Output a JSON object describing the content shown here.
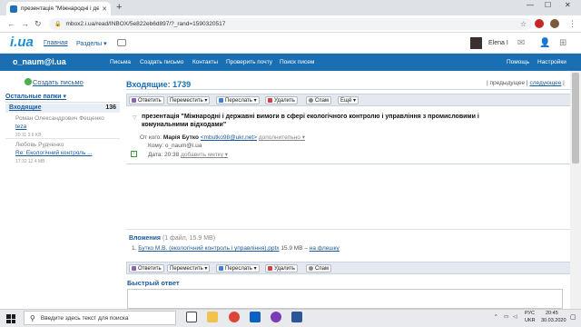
{
  "browser": {
    "tab_title": "презентація \"Міжнародні і держ",
    "tab_close": "✕",
    "new_tab": "+",
    "url": "mbox2.i.ua/read/INBOX/5e822eb6d897/?_rand=1590320517",
    "win_min": "—",
    "win_max": "☐",
    "win_close": "✕"
  },
  "site": {
    "logo_text": "i.ua",
    "nav": [
      "Главная",
      "Разделы ▾"
    ],
    "user_name": "Elena I",
    "email": "o_naum@i.ua",
    "menu": [
      "Письма",
      "Создать письмо",
      "Контакты",
      "Проверить почту",
      "Поиск писем"
    ],
    "help": "Помощь",
    "settings": "Настройки"
  },
  "sidebar": {
    "create_label": "Создать письмо",
    "folders_header": "Остальные папки ▾",
    "inbox_label": "Входящие",
    "inbox_count": "136",
    "msg1_from": "Роман Олександрович Фещенко",
    "msg1_subject": "tezа",
    "msg1_meta": "20:11 3.6 KB",
    "msg2_from": "Любовь Рудченко",
    "msg2_subject": "Re: Екологічний контроль ...",
    "msg2_meta": "17:32 12.4 MB"
  },
  "main": {
    "title": "Входящие: 1739",
    "prev": "предыдущее",
    "next": "следующее",
    "buttons": {
      "reply": "Ответить",
      "move": "Переместить ▾",
      "forward": "Переслать ▾",
      "delete": "Удалить",
      "spam": "Спам",
      "more": "Ещё ▾"
    },
    "subject": "презентація \"Міжнародні і державні вимоги в сфері екологічного контролю і управління з промисловими і комунальними відходами\"",
    "from_label": "От кого:",
    "from_name": "Марія Бутко",
    "from_email": "<mbutko98@ukr.net>",
    "more_info": "дополнительно ▾",
    "to_label": "Кому:",
    "to_value": "o_naum@i.ua",
    "date_label": "Дата:",
    "date_value": "20:38",
    "add_label": "добавить метку ▾",
    "attachments_label": "Вложения",
    "attachments_count": "(1 файл, 15.9 MB)",
    "attachment_name": "Бутко М.В. (екологічний контроль і управління).pptx",
    "attachment_size": "15.9 MB –",
    "attachment_flash": "на флешку",
    "quick_reply": "Быстрый ответ"
  },
  "taskbar": {
    "search_placeholder": "Введите здесь текст для поиска",
    "lang": "РУС",
    "lang2": "UKR",
    "time": "20:45",
    "date": "30.03.2020"
  }
}
